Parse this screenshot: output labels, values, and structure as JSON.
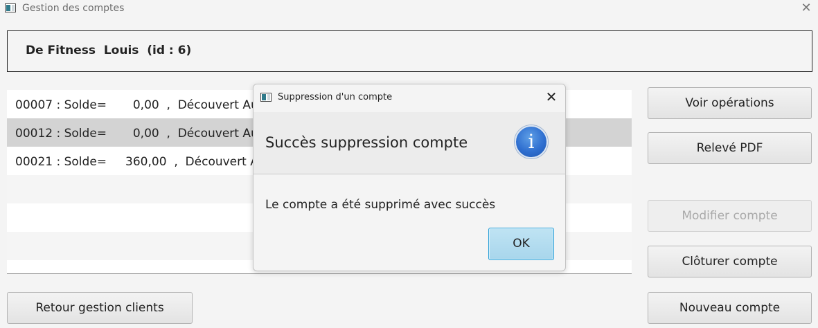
{
  "window": {
    "title": "Gestion des comptes",
    "close_symbol": "✕"
  },
  "client": {
    "label": "De Fitness  Louis  (id : 6)"
  },
  "accounts": [
    "00007 : Solde=       0,00  ,  Découvert Autorisé = -400",
    "00012 : Solde=       0,00  ,  Découvert Autorisé = -200",
    "00021 : Solde=     360,00  ,  Découvert Autorisé = -500"
  ],
  "buttons": {
    "voir": "Voir opérations",
    "releve": "Relevé PDF",
    "modifier": "Modifier compte",
    "cloturer": "Clôturer compte",
    "nouveau": "Nouveau compte",
    "retour": "Retour gestion clients"
  },
  "dialog": {
    "title": "Suppression d'un compte",
    "close_symbol": "✕",
    "heading": "Succès suppression compte",
    "info_glyph": "i",
    "message": "Le compte a été supprimé avec succès",
    "ok": "OK"
  }
}
